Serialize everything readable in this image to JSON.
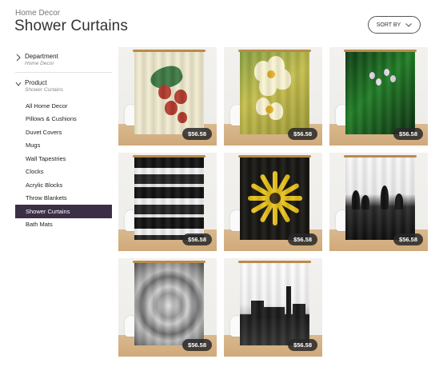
{
  "header": {
    "breadcrumb": "Home Decor",
    "title": "Shower Curtains",
    "sort_label": "SORT BY"
  },
  "filters": {
    "department": {
      "label": "Department",
      "value": "Home Decor",
      "expanded": false
    },
    "product": {
      "label": "Product",
      "value": "Shower Curtains",
      "expanded": true
    }
  },
  "categories": [
    {
      "label": "All Home Decor",
      "active": false
    },
    {
      "label": "Pillows & Cushions",
      "active": false
    },
    {
      "label": "Duvet Covers",
      "active": false
    },
    {
      "label": "Mugs",
      "active": false
    },
    {
      "label": "Wall Tapestries",
      "active": false
    },
    {
      "label": "Clocks",
      "active": false
    },
    {
      "label": "Acrylic Blocks",
      "active": false
    },
    {
      "label": "Throw Blankets",
      "active": false
    },
    {
      "label": "Shower Curtains",
      "active": true
    },
    {
      "label": "Bath Mats",
      "active": false
    }
  ],
  "products": [
    {
      "design": "strawberries",
      "price": "$56.58"
    },
    {
      "design": "narcissus",
      "price": "$56.58"
    },
    {
      "design": "green-leaves-white-flowers",
      "price": "$56.58"
    },
    {
      "design": "black-white-stripes",
      "price": "$56.58"
    },
    {
      "design": "yellow-daisy",
      "price": "$56.58"
    },
    {
      "design": "black-white-trees",
      "price": "$56.58"
    },
    {
      "design": "grey-rose",
      "price": "$56.58"
    },
    {
      "design": "london-skyline",
      "price": "$56.58"
    }
  ],
  "colors": {
    "active_category_bg": "#3a2f45",
    "price_badge_bg": "#282828"
  }
}
